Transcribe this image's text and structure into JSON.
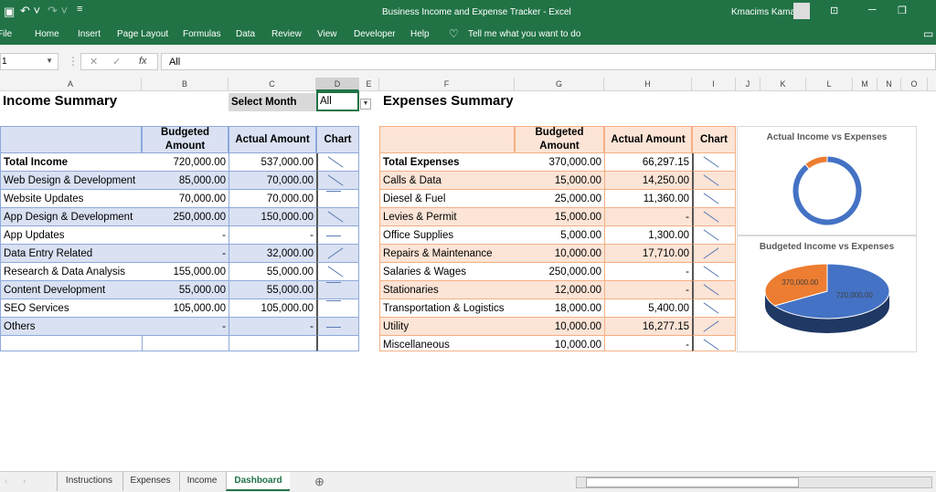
{
  "window": {
    "title": "Business Income and Expense Tracker  -  Excel",
    "user": "Kmacims Kamac"
  },
  "ribbon": {
    "tabs": [
      "File",
      "Home",
      "Insert",
      "Page Layout",
      "Formulas",
      "Data",
      "Review",
      "View",
      "Developer",
      "Help"
    ],
    "tell_me": "Tell me what you want to do"
  },
  "formula_bar": {
    "name_box": "1",
    "value": "All",
    "fx": "fx"
  },
  "columns": [
    "A",
    "B",
    "C",
    "D",
    "E",
    "F",
    "G",
    "H",
    "I",
    "J",
    "K",
    "L",
    "M",
    "N",
    "O"
  ],
  "income": {
    "title": "Income Summary",
    "select_label": "Select Month",
    "select_value": "All",
    "headers": [
      "",
      "Budgeted Amount",
      "Actual Amount",
      "Chart"
    ],
    "rows": [
      {
        "name": "Total Income",
        "budget": "720,000.00",
        "actual": "537,000.00",
        "trend": "down"
      },
      {
        "name": "Web Design & Development",
        "budget": "85,000.00",
        "actual": "70,000.00",
        "trend": "down"
      },
      {
        "name": "Website Updates",
        "budget": "70,000.00",
        "actual": "70,000.00",
        "trend": "flat-top"
      },
      {
        "name": "App Design & Development",
        "budget": "250,000.00",
        "actual": "150,000.00",
        "trend": "down"
      },
      {
        "name": "App Updates",
        "budget": "-",
        "actual": "-",
        "trend": "flat"
      },
      {
        "name": "Data Entry Related",
        "budget": "-",
        "actual": "32,000.00",
        "trend": "up"
      },
      {
        "name": "Research & Data Analysis",
        "budget": "155,000.00",
        "actual": "55,000.00",
        "trend": "down"
      },
      {
        "name": "Content Development",
        "budget": "55,000.00",
        "actual": "55,000.00",
        "trend": "flat-top"
      },
      {
        "name": "SEO Services",
        "budget": "105,000.00",
        "actual": "105,000.00",
        "trend": "flat-top"
      },
      {
        "name": "Others",
        "budget": "-",
        "actual": "-",
        "trend": "flat"
      }
    ]
  },
  "expenses": {
    "title": "Expenses Summary",
    "headers": [
      "",
      "Budgeted Amount",
      "Actual Amount",
      "Chart"
    ],
    "rows": [
      {
        "name": "Total Expenses",
        "budget": "370,000.00",
        "actual": "66,297.15",
        "trend": "down"
      },
      {
        "name": "Calls & Data",
        "budget": "15,000.00",
        "actual": "14,250.00",
        "trend": "down"
      },
      {
        "name": "Diesel & Fuel",
        "budget": "25,000.00",
        "actual": "11,360.00",
        "trend": "down"
      },
      {
        "name": "Levies & Permit",
        "budget": "15,000.00",
        "actual": "-",
        "trend": "down"
      },
      {
        "name": "Office Supplies",
        "budget": "5,000.00",
        "actual": "1,300.00",
        "trend": "down"
      },
      {
        "name": "Repairs & Maintenance",
        "budget": "10,000.00",
        "actual": "17,710.00",
        "trend": "up"
      },
      {
        "name": "Salaries & Wages",
        "budget": "250,000.00",
        "actual": "-",
        "trend": "down"
      },
      {
        "name": "Stationaries",
        "budget": "12,000.00",
        "actual": "-",
        "trend": "down"
      },
      {
        "name": "Transportation & Logistics",
        "budget": "18,000.00",
        "actual": "5,400.00",
        "trend": "down"
      },
      {
        "name": "Utility",
        "budget": "10,000.00",
        "actual": "16,277.15",
        "trend": "up"
      },
      {
        "name": "Miscellaneous",
        "budget": "10,000.00",
        "actual": "-",
        "trend": "down"
      }
    ]
  },
  "charts": {
    "donut": {
      "title": "Actual Income vs Expenses",
      "values": [
        537000,
        66297.15
      ],
      "colors": [
        "#4472c4",
        "#ed7d31"
      ]
    },
    "pie": {
      "title": "Budgeted Income vs Expenses",
      "values": [
        720000,
        370000
      ],
      "labels": [
        "720,000.00",
        "370,000.00"
      ],
      "colors": [
        "#4472c4",
        "#ed7d31"
      ]
    }
  },
  "sheet_tabs": [
    "Instructions",
    "Expenses",
    "Income",
    "Dashboard"
  ],
  "active_tab": "Dashboard"
}
